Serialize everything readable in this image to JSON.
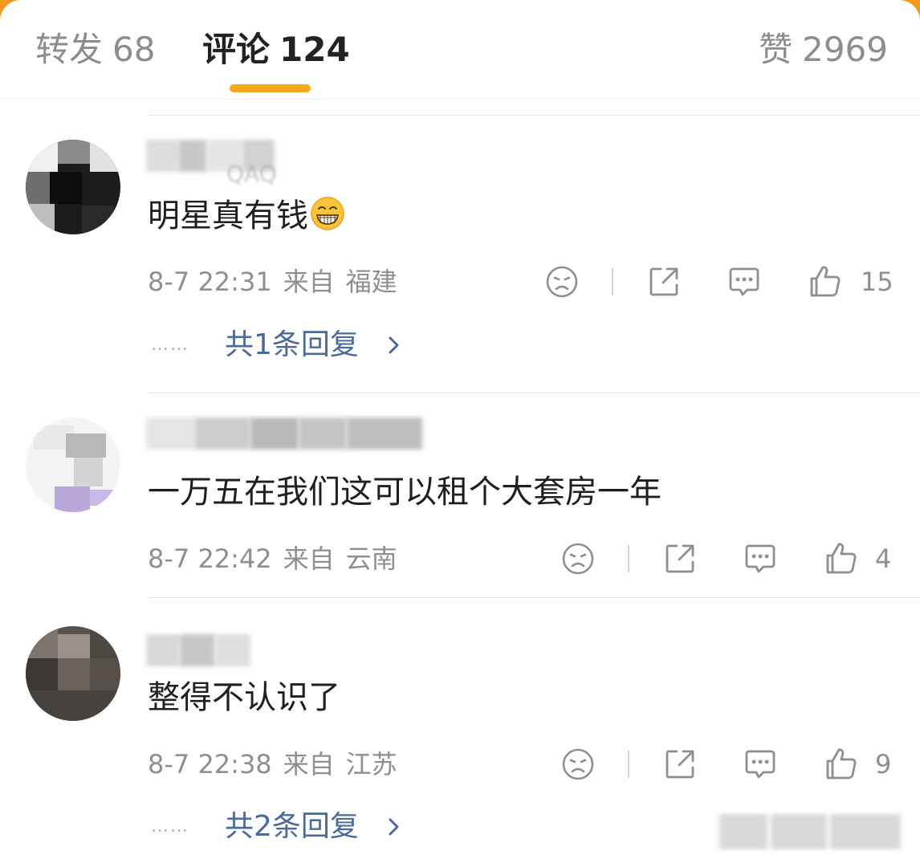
{
  "tabs": {
    "repost": {
      "label": "转发",
      "count": "68"
    },
    "comments": {
      "label": "评论",
      "count": "124"
    },
    "likes": {
      "label": "赞",
      "count": "2969"
    }
  },
  "accent_color": "#f7a81b",
  "comments": [
    {
      "username": "QAQ",
      "text": "明星真有钱",
      "emoji": "grinning-face-icon",
      "date": "8-7 22:31",
      "from_label": "来自",
      "location": "福建",
      "likes": "15",
      "replies": "共1条回复",
      "replies_dots": "……"
    },
    {
      "text": "一万五在我们这可以租个大套房一年",
      "date": "8-7 22:42",
      "from_label": "来自",
      "location": "云南",
      "likes": "4"
    },
    {
      "text": "整得不认识了",
      "date": "8-7 22:38",
      "from_label": "来自",
      "location": "江苏",
      "likes": "9",
      "replies": "共2条回复",
      "replies_dots": "……"
    }
  ]
}
